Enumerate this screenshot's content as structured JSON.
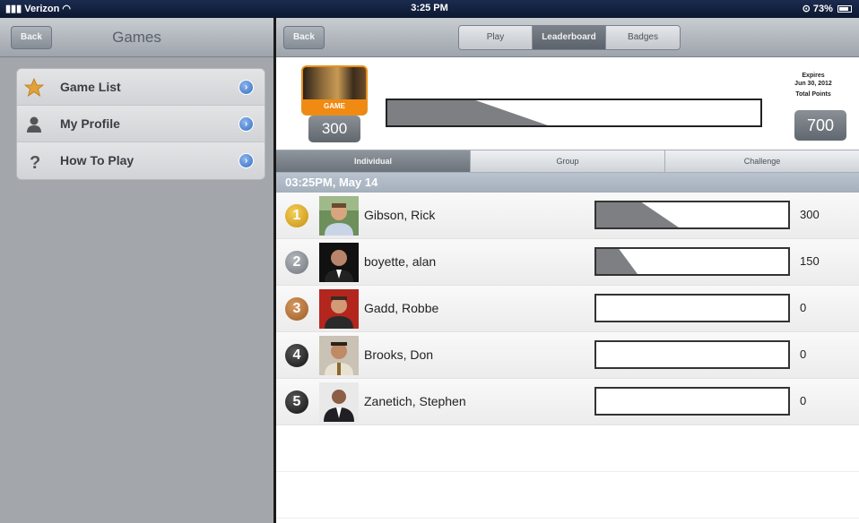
{
  "status": {
    "carrier": "Verizon",
    "time": "3:25 PM",
    "battery": "73%"
  },
  "left": {
    "back_label": "Back",
    "title": "Games",
    "menu": [
      {
        "label": "Game List",
        "icon": "star-icon"
      },
      {
        "label": "My Profile",
        "icon": "person-icon"
      },
      {
        "label": "How To Play",
        "icon": "question-icon"
      }
    ]
  },
  "right": {
    "back_label": "Back",
    "segments": [
      "Play",
      "Leaderboard",
      "Badges"
    ],
    "active_segment": "Leaderboard",
    "game": {
      "tile_label": "GAME",
      "score": "300",
      "progress_fraction": 0.43,
      "expires_label": "Expires",
      "expires_date": "Jun 30, 2012",
      "total_label": "Total Points",
      "total_points": "700"
    },
    "tabs": [
      "Individual",
      "Group",
      "Challenge"
    ],
    "active_tab": "Individual",
    "date_header": "03:25PM, May 14",
    "rows": [
      {
        "rank": "1",
        "name": "Gibson, Rick",
        "points": "300",
        "fraction": 0.43
      },
      {
        "rank": "2",
        "name": "boyette, alan",
        "points": "150",
        "fraction": 0.215
      },
      {
        "rank": "3",
        "name": "Gadd, Robbe",
        "points": "0",
        "fraction": 0
      },
      {
        "rank": "4",
        "name": "Brooks, Don",
        "points": "0",
        "fraction": 0
      },
      {
        "rank": "5",
        "name": "Zanetich, Stephen",
        "points": "0",
        "fraction": 0
      }
    ]
  },
  "colors": {
    "accent_orange": "#f08a12",
    "bar_fill": "#7d7f82",
    "disclosure_blue": "#2f6cc7"
  }
}
